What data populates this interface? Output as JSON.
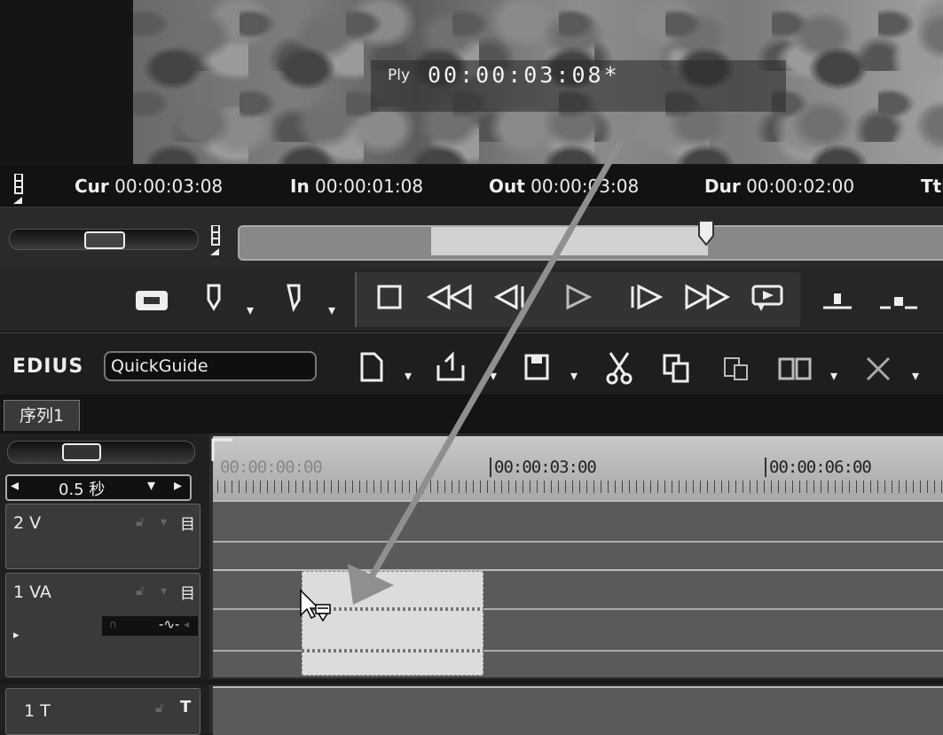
{
  "preview": {
    "ply_label": "Ply",
    "ply_timecode": "00:00:03:08*"
  },
  "timecodes": {
    "cur_label": "Cur",
    "cur_value": "00:00:03:08",
    "in_label": "In",
    "in_value": "00:00:01:08",
    "out_label": "Out",
    "out_value": "00:00:03:08",
    "dur_label": "Dur",
    "dur_value": "00:00:02:00",
    "ttl_label": "Ttl"
  },
  "toolbar": {
    "logo": "EDIUS",
    "project_name": "QuickGuide"
  },
  "sequence_tab": "序列1",
  "timeline": {
    "scale": "0.5 秒",
    "ruler_labels": [
      "00:00:00:00",
      "00:00:03:00",
      "00:00:06:00"
    ],
    "tracks": [
      {
        "name": "2 V"
      },
      {
        "name": "1 VA"
      },
      {
        "name": "1 T"
      }
    ]
  },
  "colors": {
    "panel": "#2c2c2c",
    "clip": "#dcdcdc",
    "arrow": "#8f8f8f"
  }
}
